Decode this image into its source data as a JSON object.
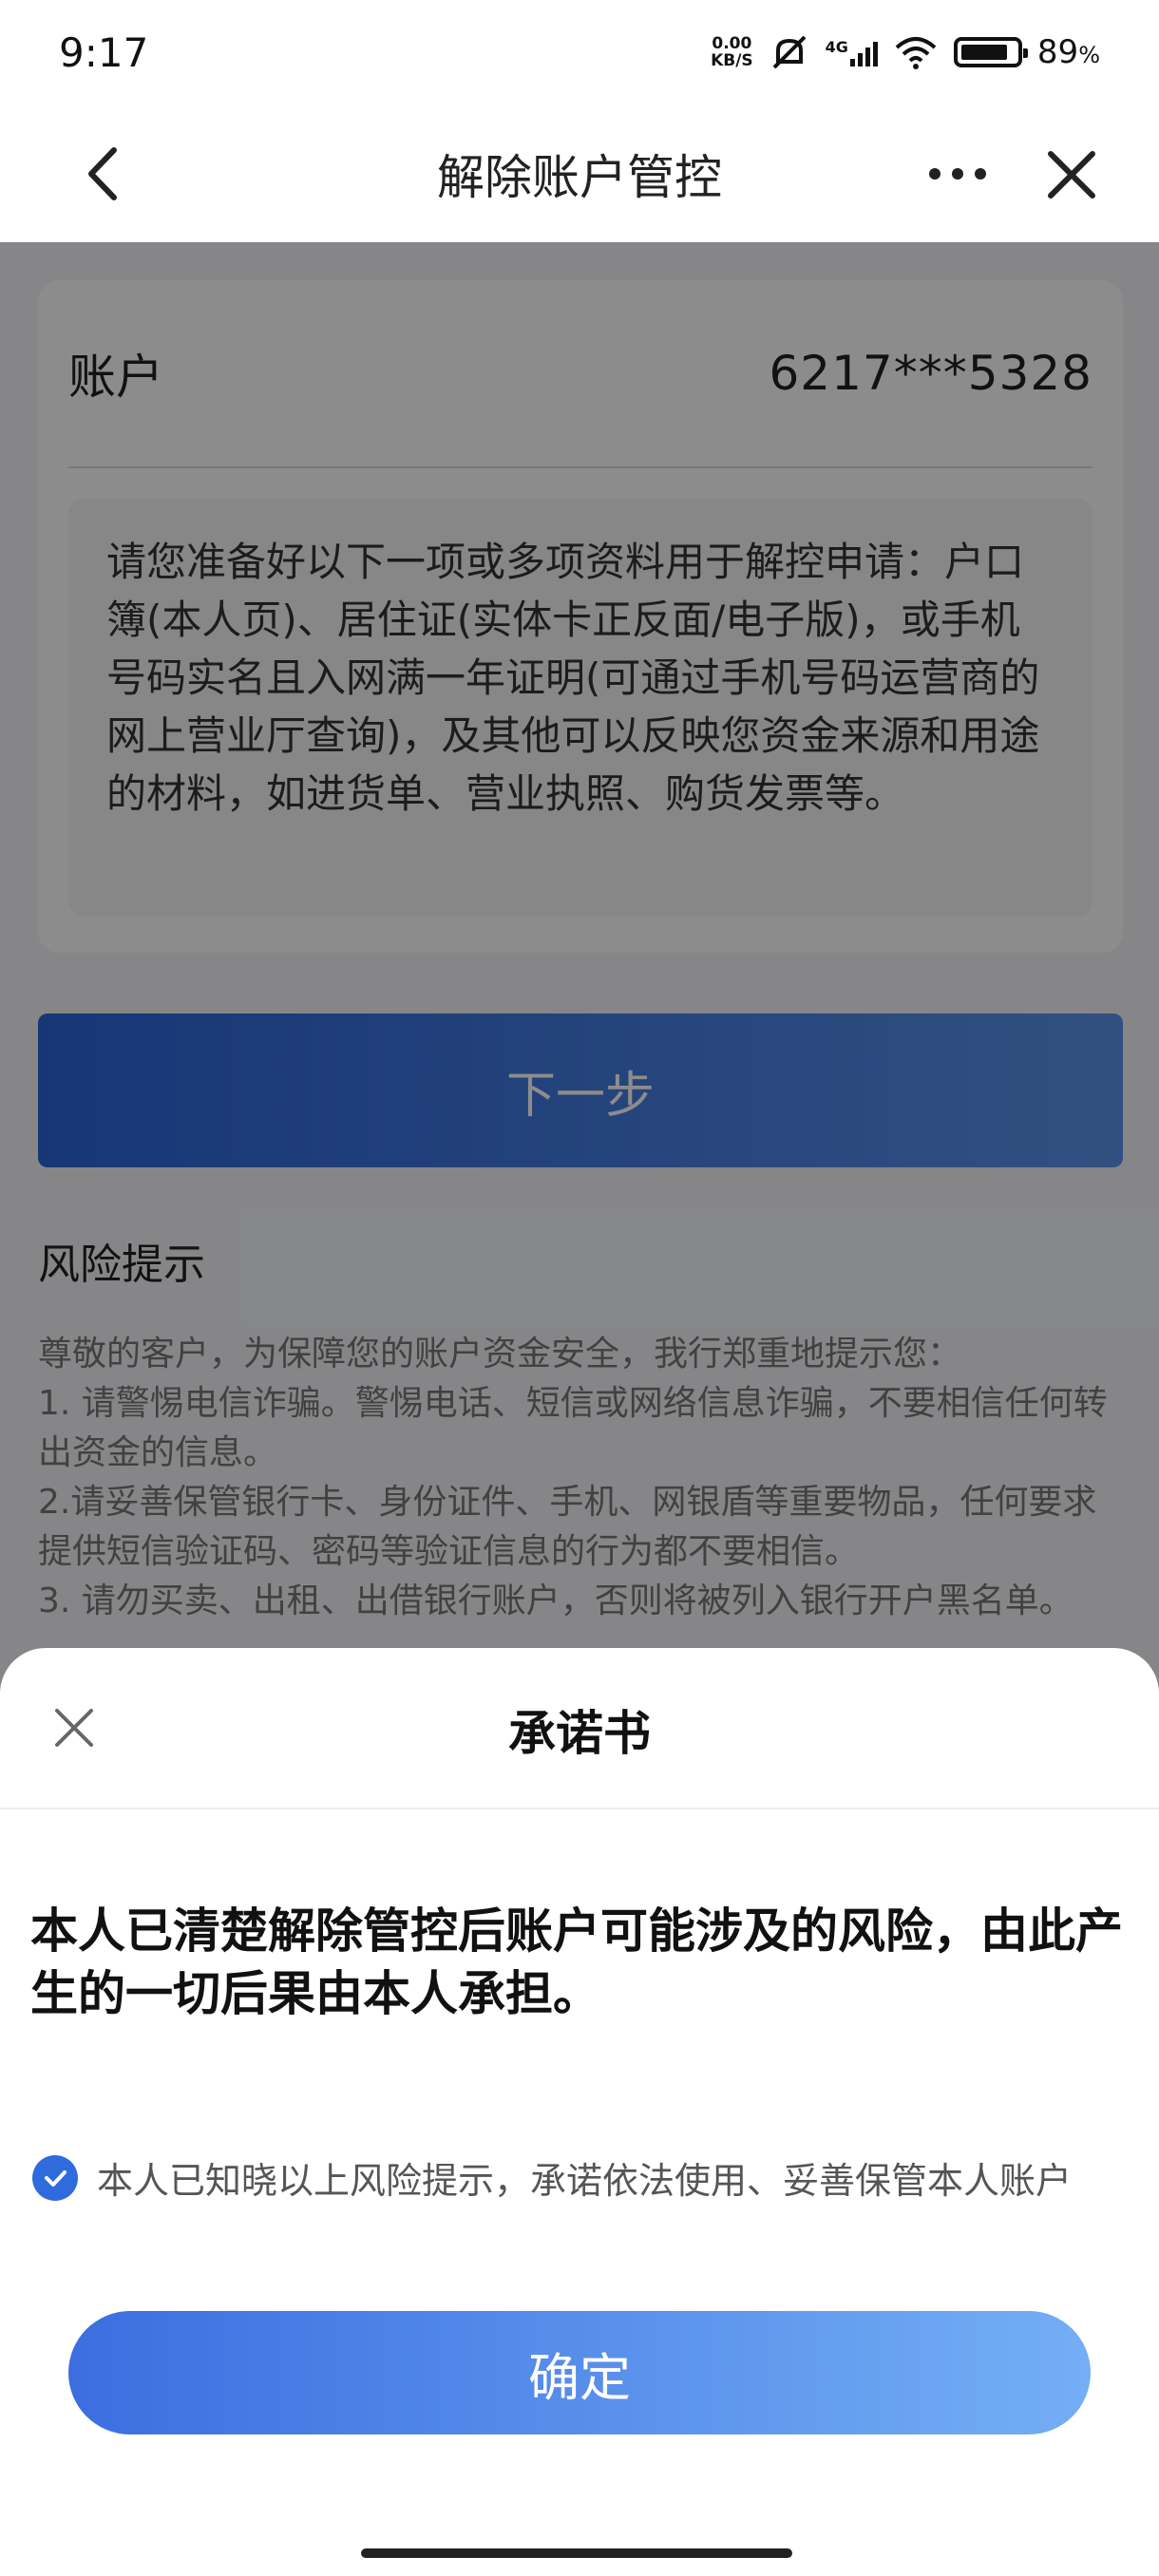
{
  "status_bar": {
    "time": "9:17",
    "net_speed_value": "0.00",
    "net_speed_unit": "KB/S",
    "network": "4G",
    "battery": "89",
    "battery_unit": "%"
  },
  "nav": {
    "title": "解除账户管控",
    "back_icon": "chevron-left-icon",
    "more_icon": "more-dots-icon",
    "close_icon": "close-icon"
  },
  "account": {
    "label": "账户",
    "value": "6217***5328"
  },
  "info_text": "请您准备好以下一项或多项资料用于解控申请：户口簿(本人页)、居住证(实体卡正反面/电子版)，或手机号码实名且入网满一年证明(可通过手机号码运营商的网上营业厅查询)，及其他可以反映您资金来源和用途的材料，如进货单、营业执照、购货发票等。",
  "next_button": "下一步",
  "risk": {
    "title": "风险提示",
    "lines": [
      "尊敬的客户，为保障您的账户资金安全，我行郑重地提示您：",
      "1. 请警惕电信诈骗。警惕电话、短信或网络信息诈骗，不要相信任何转出资金的信息。",
      "2.请妥善保管银行卡、身份证件、手机、网银盾等重要物品，任何要求提供短信验证码、密码等验证信息的行为都不要相信。",
      "3. 请勿买卖、出租、出借银行账户，否则将被列入银行开户黑名单。"
    ]
  },
  "sheet": {
    "title": "承诺书",
    "pledge": "本人已清楚解除管控后账户可能涉及的风险，由此产生的一切后果由本人承担。",
    "agree_text": "本人已知晓以上风险提示，承诺依法使用、妥善保管本人账户",
    "agree_checked": true,
    "confirm": "确定"
  },
  "colors": {
    "primary": "#2f6bdc",
    "button_gradient_start": "#3c6ee0",
    "button_gradient_end": "#74aef5"
  }
}
